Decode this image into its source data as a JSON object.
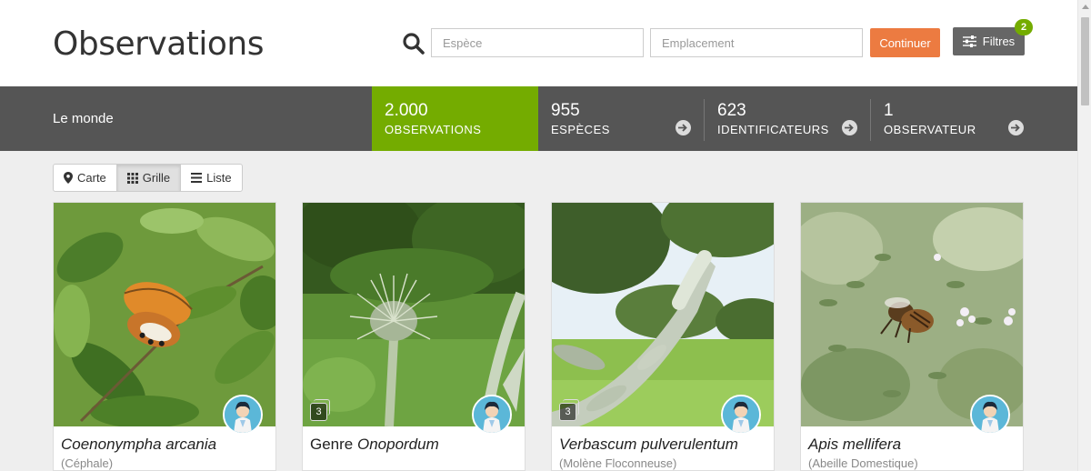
{
  "header": {
    "title": "Observations",
    "species_placeholder": "Espèce",
    "location_placeholder": "Emplacement",
    "continue_label": "Continuer",
    "filters_label": "Filtres",
    "filters_count": "2"
  },
  "stats": {
    "place": "Le monde",
    "observations": {
      "value": "2.000",
      "label": "OBSERVATIONS"
    },
    "species": {
      "value": "955",
      "label": "ESPÈCES"
    },
    "identifiers": {
      "value": "623",
      "label": "IDENTIFICATEURS"
    },
    "observers": {
      "value": "1",
      "label": "OBSERVATEUR"
    }
  },
  "view_toggle": {
    "map": "Carte",
    "grid": "Grille",
    "list": "Liste",
    "active": "grid"
  },
  "cards": [
    {
      "prefix": "",
      "name": "Coenonympha arcania",
      "common": "(Céphale)",
      "photo_count": ""
    },
    {
      "prefix": "Genre ",
      "name": "Onopordum",
      "common": "",
      "photo_count": "3"
    },
    {
      "prefix": "",
      "name": "Verbascum pulverulentum",
      "common": "(Molène Floconneuse)",
      "photo_count": "3"
    },
    {
      "prefix": "",
      "name": "Apis mellifera",
      "common": "(Abeille Domestique)",
      "photo_count": ""
    }
  ],
  "colors": {
    "accent_green": "#74ac00",
    "continue_orange": "#ec7b41",
    "stats_bar": "#555555"
  }
}
